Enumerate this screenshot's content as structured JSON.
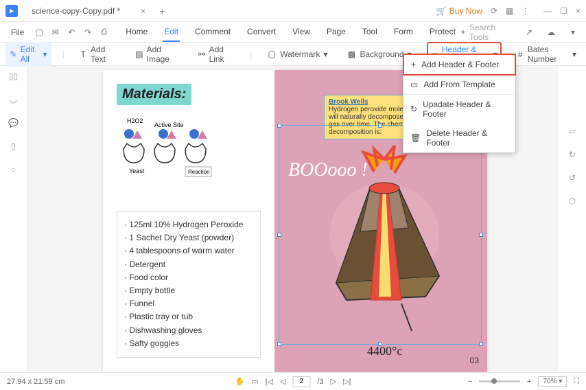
{
  "titlebar": {
    "filename": "science-copy-Copy.pdf *",
    "buy_now": "Buy Now"
  },
  "menubar": {
    "file": "File",
    "tabs": [
      "Home",
      "Edit",
      "Comment",
      "Convert",
      "View",
      "Page",
      "Tool",
      "Form",
      "Protect"
    ],
    "active_index": 1,
    "search_placeholder": "Search Tools"
  },
  "toolbar": {
    "edit_all": "Edit All",
    "add_text": "Add Text",
    "add_image": "Add Image",
    "add_link": "Add Link",
    "watermark": "Watermark",
    "background": "Background",
    "header_footer": "Header & Footer",
    "bates_number": "Bates Number"
  },
  "dropdown": {
    "add": "Add Header & Footer",
    "template": "Add From Template",
    "update": "Upadate Header & Footer",
    "delete": "Delete Header & Footer"
  },
  "document": {
    "materials_heading": "Materials:",
    "h2o2": "H2O2",
    "active_site": "Active Site",
    "yeast": "Yeast",
    "reaction": "Reaction",
    "ingredients": [
      "125ml 10% Hydrogen Peroxide",
      "1 Sachet Dry Yeast (powder)",
      "4 tablespoons of warm water",
      "Detergent",
      "Food color",
      "Empty bottle",
      "Funnel",
      "Plastic tray or tub",
      "Dishwashing gloves",
      "Safty goggles"
    ],
    "sticky_author": "Brook Wells",
    "sticky_text": "Hydrogen peroxide molecules are unstable and will naturally decompose into water and oxygen gas over time. The chemical equation for this decomposition is:",
    "boo": "BOOooo !",
    "temp": "4400°c",
    "page_number": "03"
  },
  "statusbar": {
    "dimensions": "27.94 x 21.59 cm",
    "page_current": "2",
    "page_total": "/3",
    "zoom": "70%"
  }
}
